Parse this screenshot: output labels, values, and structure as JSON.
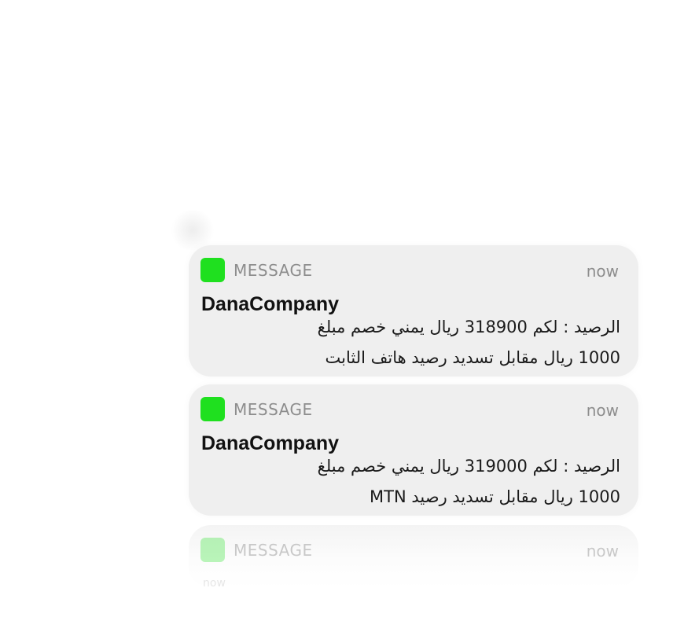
{
  "notifications": [
    {
      "app_name": "MESSAGE",
      "time": "now",
      "sender": "DanaCompany",
      "body_line1": "الرصيد : لكم 318900 ريال يمني خصم مبلغ",
      "body_line2": "1000 ريال مقابل تسديد رصيد هاتف الثابت"
    },
    {
      "app_name": "MESSAGE",
      "time": "now",
      "sender": "DanaCompany",
      "body_line1": "الرصيد : لكم 319000 ريال يمني خصم مبلغ",
      "body_line2": "1000 ريال مقابل تسديد رصيد MTN"
    },
    {
      "app_name": "MESSAGE",
      "time": "now",
      "faded_time": "now"
    }
  ],
  "colors": {
    "app_icon": "#1fe01f",
    "card_background": "#efefef",
    "muted_text": "#8d8d8d"
  },
  "icons": {
    "app_icon": "message-app-icon"
  }
}
